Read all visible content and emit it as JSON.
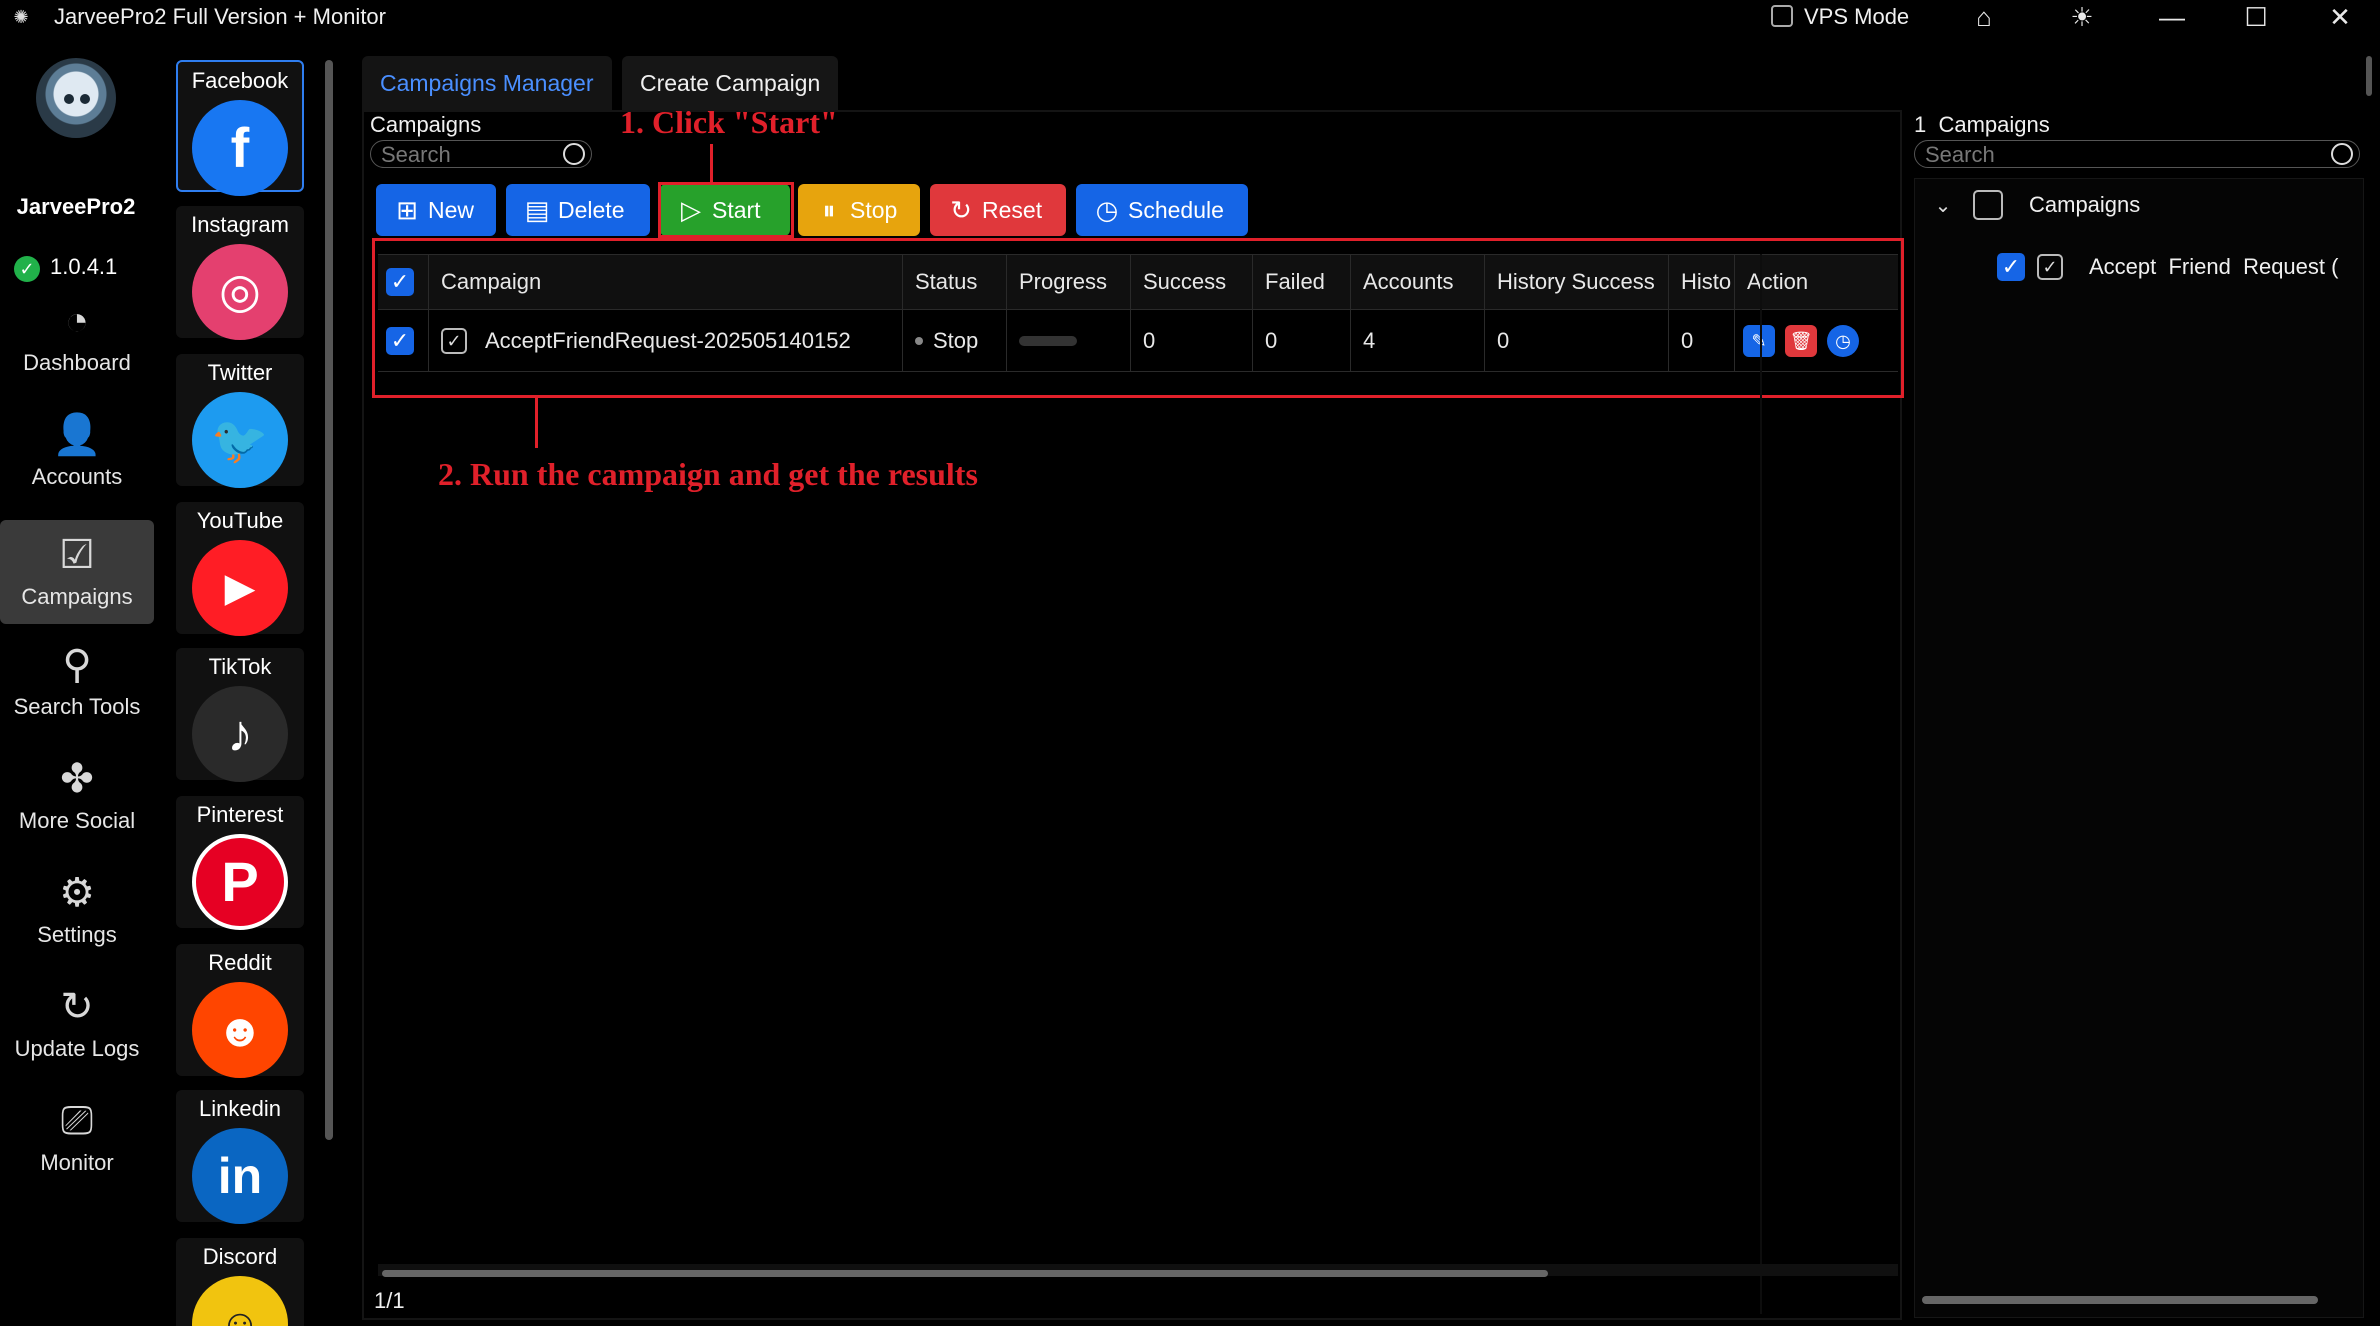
{
  "window": {
    "title": "JarveePro2 Full Version + Monitor",
    "vps_mode_label": "VPS Mode",
    "vps_mode_checked": false
  },
  "brand": {
    "name": "JarveePro2",
    "version": "1.0.4.1"
  },
  "nav": {
    "items": [
      {
        "label": "Dashboard",
        "icon": "dashboard-icon"
      },
      {
        "label": "Accounts",
        "icon": "accounts-icon"
      },
      {
        "label": "Campaigns",
        "icon": "campaigns-icon",
        "active": true
      },
      {
        "label": "Search Tools",
        "icon": "search-icon"
      },
      {
        "label": "More Social",
        "icon": "more-social-icon"
      },
      {
        "label": "Settings",
        "icon": "gear-icon"
      },
      {
        "label": "Update Logs",
        "icon": "update-logs-icon"
      },
      {
        "label": "Monitor",
        "icon": "monitor-icon"
      }
    ]
  },
  "social": {
    "items": [
      {
        "label": "Facebook",
        "icon": "facebook-icon",
        "color": "#1877f2",
        "active": true
      },
      {
        "label": "Instagram",
        "icon": "instagram-icon",
        "color": "#e4406f"
      },
      {
        "label": "Twitter",
        "icon": "twitter-icon",
        "color": "#1d9bf0"
      },
      {
        "label": "YouTube",
        "icon": "youtube-icon",
        "color": "#ff1d25"
      },
      {
        "label": "TikTok",
        "icon": "tiktok-icon",
        "color": "#2a2a2a"
      },
      {
        "label": "Pinterest",
        "icon": "pinterest-icon",
        "color": "#e60023"
      },
      {
        "label": "Reddit",
        "icon": "reddit-icon",
        "color": "#ff4500"
      },
      {
        "label": "Linkedin",
        "icon": "linkedin-icon",
        "color": "#0a66c2"
      },
      {
        "label": "Discord",
        "icon": "discord-icon",
        "color": "#f1c40f"
      }
    ]
  },
  "tabs": [
    {
      "label": "Campaigns Manager",
      "active": true
    },
    {
      "label": "Create Campaign",
      "active": false
    }
  ],
  "left_panel": {
    "label": "Campaigns",
    "search_placeholder": "Search"
  },
  "toolbar": {
    "new": "New",
    "delete": "Delete",
    "start": "Start",
    "stop": "Stop",
    "reset": "Reset",
    "schedule": "Schedule"
  },
  "annotations": {
    "step1": "1. Click \"Start\"",
    "step2": "2. Run the campaign and get the results"
  },
  "table": {
    "columns": [
      "Campaign",
      "Status",
      "Progress",
      "Success",
      "Failed",
      "Accounts",
      "History Success",
      "Histo",
      "Action"
    ],
    "rows": [
      {
        "checked": true,
        "campaign": "AcceptFriendRequest-202505140152",
        "status": "Stop",
        "progress": 0,
        "success": "0",
        "failed": "0",
        "accounts": "4",
        "history_success": "0",
        "history_failed": "0"
      }
    ],
    "pager": "1/1"
  },
  "right_panel": {
    "count": "1",
    "label": "Campaigns",
    "search_placeholder": "Search",
    "tree_root": "Campaigns",
    "tree_child": "Accept  Friend  Request ("
  },
  "colors": {
    "accent_blue": "#1565e6",
    "start_green": "#27a12b",
    "stop_yellow": "#e7a40d",
    "reset_red": "#e0383c",
    "annotation_red": "#e0202a"
  }
}
